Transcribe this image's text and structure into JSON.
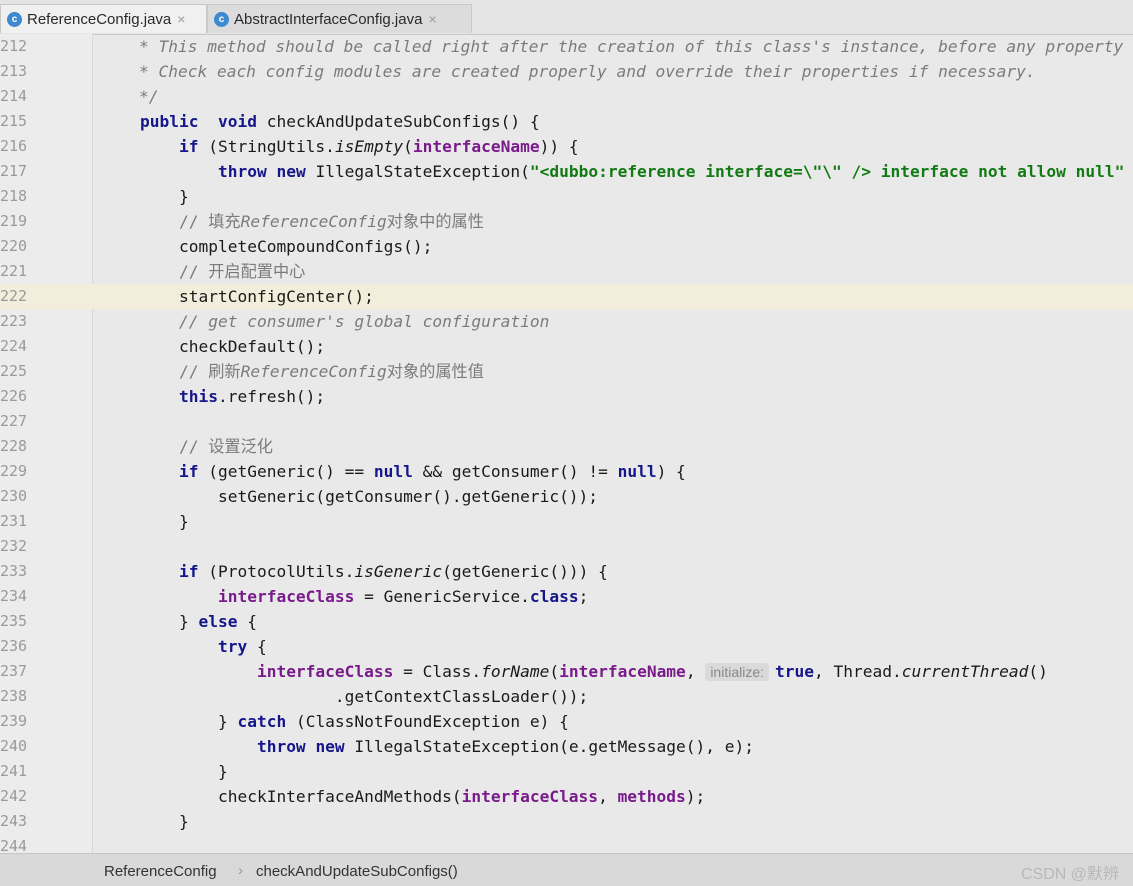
{
  "tabs": [
    {
      "label": "ReferenceConfig.java",
      "icon": "class-icon",
      "active": true
    },
    {
      "label": "AbstractInterfaceConfig.java",
      "icon": "class-icon",
      "active": false
    }
  ],
  "lines": [
    {
      "n": "212",
      "tokens": [
        [
          "cm",
          "    * This method should be called right after the creation of this class's instance, before any property"
        ]
      ]
    },
    {
      "n": "213",
      "tokens": [
        [
          "cm",
          "    * Check each config modules are created properly and override their properties if necessary."
        ]
      ]
    },
    {
      "n": "214",
      "tokens": [
        [
          "cm",
          "    */"
        ]
      ]
    },
    {
      "n": "215",
      "tokens": [
        [
          "kw",
          "public"
        ],
        [
          "",
          "  "
        ],
        [
          "kw",
          "void"
        ],
        [
          "",
          " checkAndUpdateSubConfigs() {"
        ]
      ]
    },
    {
      "n": "216",
      "tokens": [
        [
          "",
          "    "
        ],
        [
          "kw",
          "if"
        ],
        [
          "",
          " (StringUtils."
        ],
        [
          "it",
          "isEmpty"
        ],
        [
          "",
          "("
        ],
        [
          "fld",
          "interfaceName"
        ],
        [
          "",
          ")) {"
        ]
      ]
    },
    {
      "n": "217",
      "tokens": [
        [
          "",
          "        "
        ],
        [
          "kw",
          "throw"
        ],
        [
          "",
          " "
        ],
        [
          "kw",
          "new"
        ],
        [
          "",
          " IllegalStateException("
        ],
        [
          "st",
          "\"<dubbo:reference interface=\\\"\\\" /> interface not allow null\""
        ]
      ]
    },
    {
      "n": "218",
      "tokens": [
        [
          "",
          "    }"
        ]
      ]
    },
    {
      "n": "219",
      "tokens": [
        [
          "",
          "    "
        ],
        [
          "cmn",
          "// 填充"
        ],
        [
          "cm",
          "ReferenceConfig"
        ],
        [
          "cmn",
          "对象中的属性"
        ]
      ]
    },
    {
      "n": "220",
      "tokens": [
        [
          "",
          "    completeCompoundConfigs();"
        ]
      ]
    },
    {
      "n": "221",
      "tokens": [
        [
          "",
          "    "
        ],
        [
          "cmn",
          "// 开启配置中心"
        ]
      ]
    },
    {
      "n": "222",
      "tokens": [
        [
          "",
          "    startConfigCenter();"
        ]
      ],
      "highlight": true
    },
    {
      "n": "223",
      "tokens": [
        [
          "",
          "    "
        ],
        [
          "cm",
          "// get consumer's global configuration"
        ]
      ]
    },
    {
      "n": "224",
      "tokens": [
        [
          "",
          "    checkDefault();"
        ]
      ]
    },
    {
      "n": "225",
      "tokens": [
        [
          "",
          "    "
        ],
        [
          "cmn",
          "// 刷新"
        ],
        [
          "cm",
          "ReferenceConfig"
        ],
        [
          "cmn",
          "对象的属性值"
        ]
      ]
    },
    {
      "n": "226",
      "tokens": [
        [
          "",
          "    "
        ],
        [
          "kw",
          "this"
        ],
        [
          "",
          ".refresh();"
        ]
      ]
    },
    {
      "n": "227",
      "tokens": [
        [
          "",
          ""
        ]
      ]
    },
    {
      "n": "228",
      "tokens": [
        [
          "",
          "    "
        ],
        [
          "cmn",
          "// 设置泛化"
        ]
      ]
    },
    {
      "n": "229",
      "tokens": [
        [
          "",
          "    "
        ],
        [
          "kw",
          "if"
        ],
        [
          "",
          " (getGeneric() == "
        ],
        [
          "kw",
          "null"
        ],
        [
          "",
          " && getConsumer() != "
        ],
        [
          "kw",
          "null"
        ],
        [
          "",
          ") {"
        ]
      ]
    },
    {
      "n": "230",
      "tokens": [
        [
          "",
          "        setGeneric(getConsumer().getGeneric());"
        ]
      ]
    },
    {
      "n": "231",
      "tokens": [
        [
          "",
          "    }"
        ]
      ]
    },
    {
      "n": "232",
      "tokens": [
        [
          "",
          ""
        ]
      ]
    },
    {
      "n": "233",
      "tokens": [
        [
          "",
          "    "
        ],
        [
          "kw",
          "if"
        ],
        [
          "",
          " (ProtocolUtils."
        ],
        [
          "it",
          "isGeneric"
        ],
        [
          "",
          "(getGeneric())) {"
        ]
      ]
    },
    {
      "n": "234",
      "tokens": [
        [
          "",
          "        "
        ],
        [
          "fld",
          "interfaceClass"
        ],
        [
          "",
          " = GenericService."
        ],
        [
          "kw",
          "class"
        ],
        [
          "",
          ";"
        ]
      ]
    },
    {
      "n": "235",
      "tokens": [
        [
          "",
          "    } "
        ],
        [
          "kw",
          "else"
        ],
        [
          "",
          " {"
        ]
      ]
    },
    {
      "n": "236",
      "tokens": [
        [
          "",
          "        "
        ],
        [
          "kw",
          "try"
        ],
        [
          "",
          " {"
        ]
      ]
    },
    {
      "n": "237",
      "tokens": [
        [
          "",
          "            "
        ],
        [
          "fld",
          "interfaceClass"
        ],
        [
          "",
          " = Class."
        ],
        [
          "it",
          "forName"
        ],
        [
          "",
          "("
        ],
        [
          "fld",
          "interfaceName"
        ],
        [
          "",
          ", "
        ],
        [
          "inlay",
          "initialize:"
        ],
        [
          "kw",
          "true"
        ],
        [
          "",
          ", Thread."
        ],
        [
          "it",
          "currentThread"
        ],
        [
          "",
          "()"
        ]
      ]
    },
    {
      "n": "238",
      "tokens": [
        [
          "",
          "                    .getContextClassLoader());"
        ]
      ]
    },
    {
      "n": "239",
      "tokens": [
        [
          "",
          "        } "
        ],
        [
          "kw",
          "catch"
        ],
        [
          "",
          " (ClassNotFoundException e) {"
        ]
      ]
    },
    {
      "n": "240",
      "tokens": [
        [
          "",
          "            "
        ],
        [
          "kw",
          "throw"
        ],
        [
          "",
          " "
        ],
        [
          "kw",
          "new"
        ],
        [
          "",
          " IllegalStateException(e.getMessage(), e);"
        ]
      ]
    },
    {
      "n": "241",
      "tokens": [
        [
          "",
          "        }"
        ]
      ]
    },
    {
      "n": "242",
      "tokens": [
        [
          "",
          "        checkInterfaceAndMethods("
        ],
        [
          "fld",
          "interfaceClass"
        ],
        [
          "",
          ", "
        ],
        [
          "fld",
          "methods"
        ],
        [
          "",
          ");"
        ]
      ]
    },
    {
      "n": "243",
      "tokens": [
        [
          "",
          "    }"
        ]
      ]
    },
    {
      "n": "244",
      "tokens": [
        [
          "",
          ""
        ]
      ]
    }
  ],
  "breadcrumb": {
    "class_name": "ReferenceConfig",
    "method_name": "checkAndUpdateSubConfigs()",
    "separator": "›"
  },
  "watermark": "CSDN @默辨",
  "colors": {
    "keyword": "#14168a",
    "field": "#7a1b8c",
    "string": "#127a12",
    "comment": "#7b7b7b",
    "caret_line": "#f2eedb"
  }
}
